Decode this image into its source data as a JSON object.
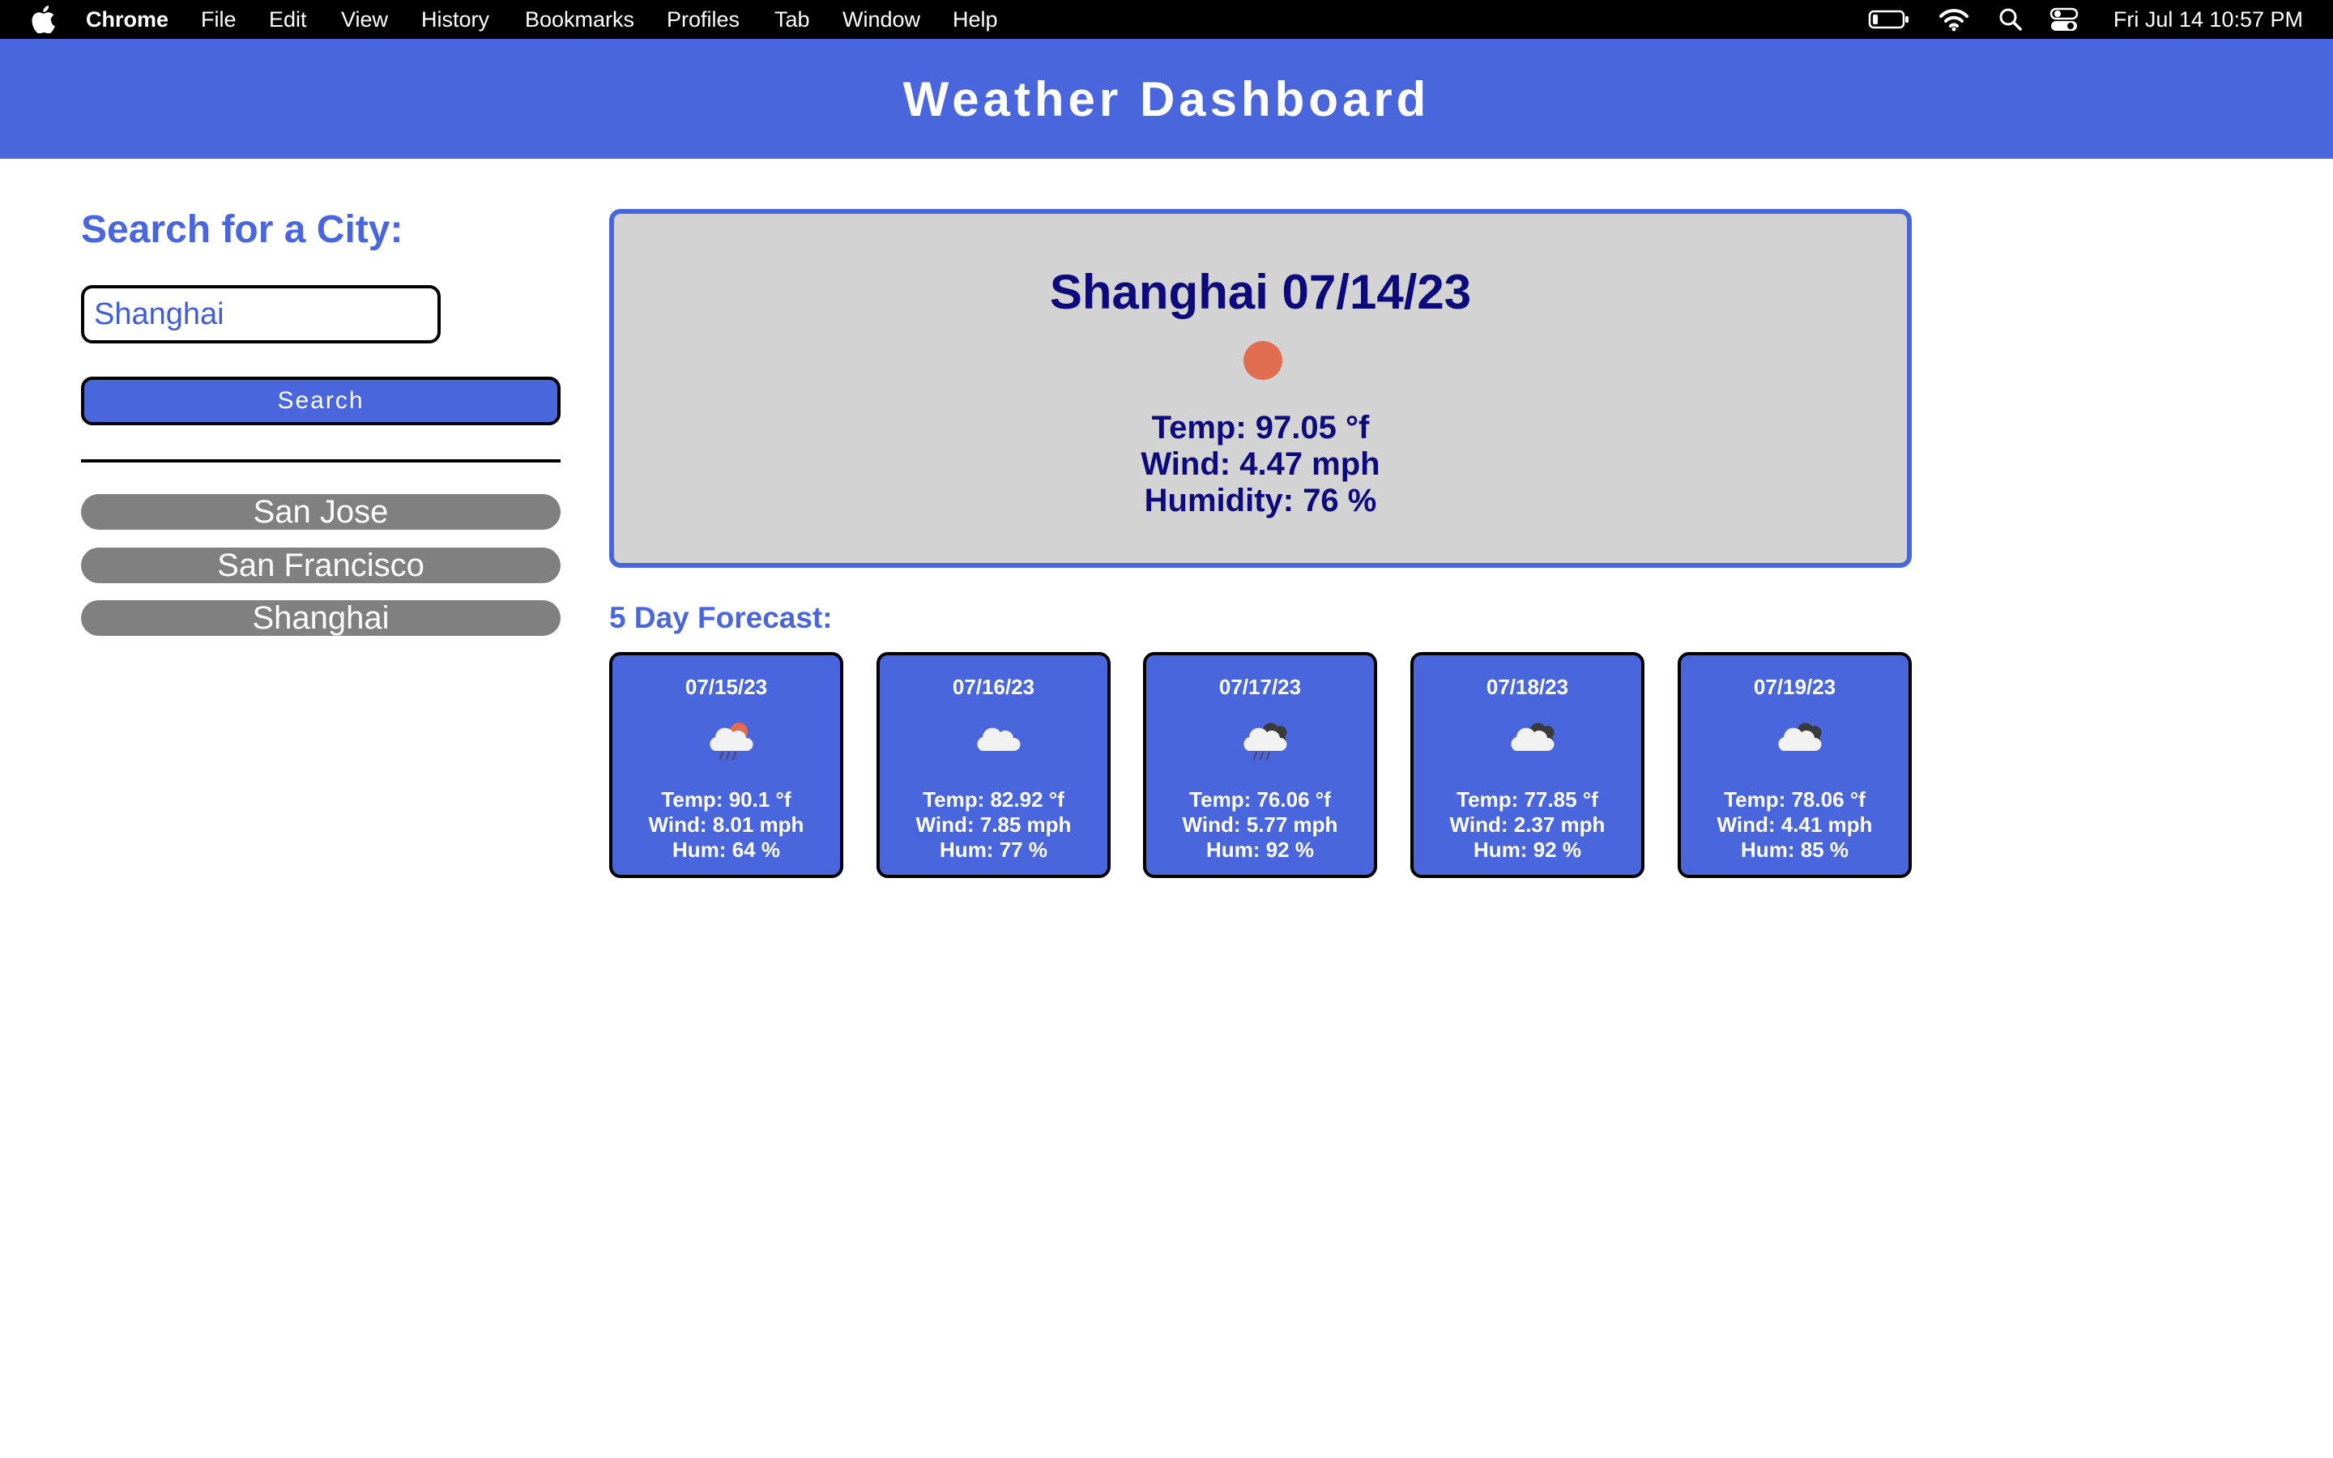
{
  "menubar": {
    "apple_icon": "apple-logo-icon",
    "app_name": "Chrome",
    "items": [
      "File",
      "Edit",
      "View",
      "History",
      "Bookmarks",
      "Profiles",
      "Tab",
      "Window",
      "Help"
    ],
    "status_icons": [
      "battery-icon",
      "wifi-icon",
      "search-icon",
      "control-center-icon"
    ],
    "clock": "Fri Jul 14  10:57 PM"
  },
  "header": {
    "title": "Weather Dashboard"
  },
  "search": {
    "heading": "Search for a City:",
    "input_value": "Shanghai",
    "button_label": "Search"
  },
  "history": [
    "San Jose",
    "San Francisco",
    "Shanghai"
  ],
  "current": {
    "title": "Shanghai 07/14/23",
    "icon": "clear-sky-sun-icon",
    "temp": "Temp: 97.05 °f",
    "wind": "Wind: 4.47 mph",
    "humidity": "Humidity: 76 %"
  },
  "forecast": {
    "heading": "5 Day Forecast:",
    "days": [
      {
        "date": "07/15/23",
        "icon": "rain-sun-icon",
        "temp": "Temp: 90.1 °f",
        "wind": "Wind: 8.01 mph",
        "hum": "Hum: 64 %"
      },
      {
        "date": "07/16/23",
        "icon": "cloud-icon",
        "temp": "Temp: 82.92 °f",
        "wind": "Wind: 7.85 mph",
        "hum": "Hum: 77 %"
      },
      {
        "date": "07/17/23",
        "icon": "rain-cloud-icon",
        "temp": "Temp: 76.06 °f",
        "wind": "Wind: 5.77 mph",
        "hum": "Hum: 92 %"
      },
      {
        "date": "07/18/23",
        "icon": "broken-clouds-icon",
        "temp": "Temp: 77.85 °f",
        "wind": "Wind: 2.37 mph",
        "hum": "Hum: 92 %"
      },
      {
        "date": "07/19/23",
        "icon": "broken-clouds-icon",
        "temp": "Temp: 78.06 °f",
        "wind": "Wind: 4.41 mph",
        "hum": "Hum: 85 %"
      }
    ]
  },
  "colors": {
    "primary": "#4a66dc",
    "dark_text": "#0d0a7c",
    "card_bg": "#d3d3d3",
    "history_bg": "#808080",
    "sun": "#e06d4f"
  }
}
